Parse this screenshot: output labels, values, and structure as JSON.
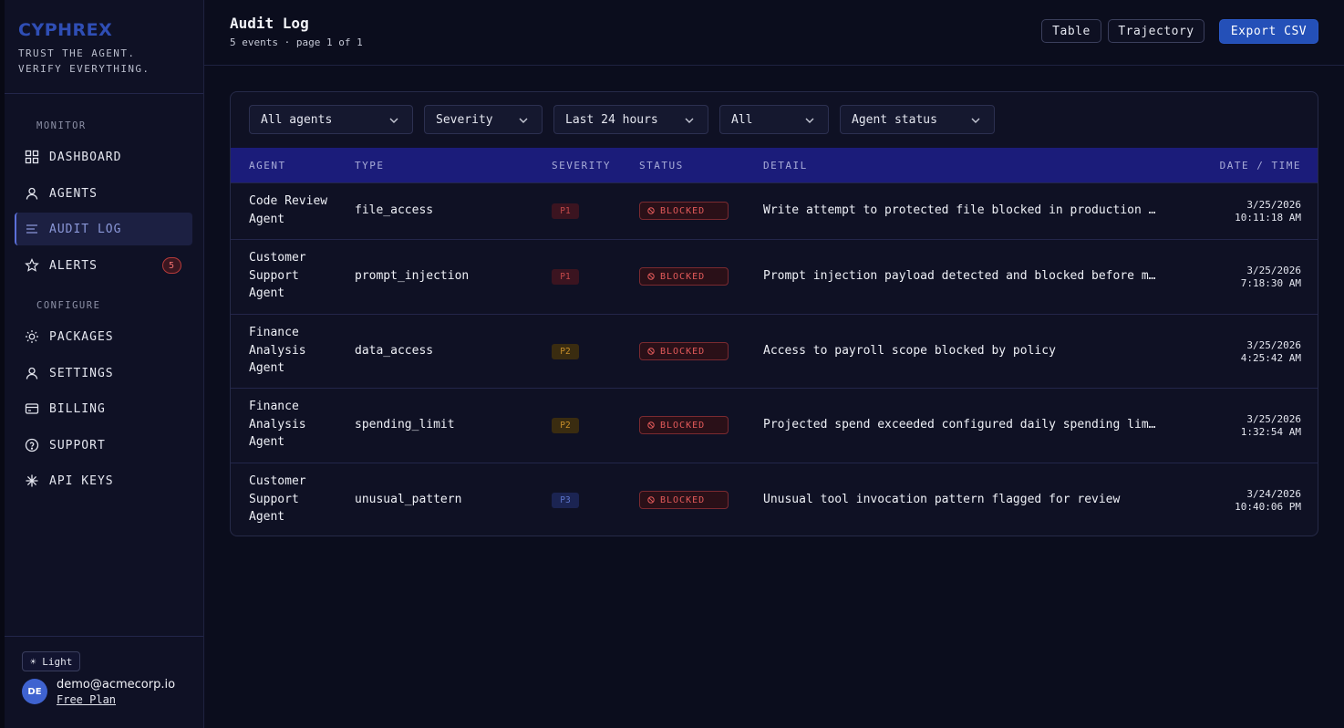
{
  "brand": {
    "logo": "CYPHREX",
    "tagline_1": "TRUST THE AGENT.",
    "tagline_2": "VERIFY EVERYTHING."
  },
  "sidebar": {
    "monitor_label": "MONITOR",
    "configure_label": "CONFIGURE",
    "items": [
      {
        "label": "DASHBOARD",
        "icon": "grid-icon"
      },
      {
        "label": "AGENTS",
        "icon": "user-icon"
      },
      {
        "label": "AUDIT LOG",
        "icon": "list-icon",
        "active": true
      },
      {
        "label": "ALERTS",
        "icon": "star-icon",
        "badge": "5"
      },
      {
        "label": "PACKAGES",
        "icon": "sun-icon"
      },
      {
        "label": "SETTINGS",
        "icon": "user-icon"
      },
      {
        "label": "BILLING",
        "icon": "card-icon"
      },
      {
        "label": "SUPPORT",
        "icon": "help-icon"
      },
      {
        "label": "API KEYS",
        "icon": "asterisk-icon"
      }
    ],
    "theme_toggle": "☀ Light",
    "user": {
      "initials": "DE",
      "email": "demo@acmecorp.io",
      "plan": "Free Plan"
    }
  },
  "header": {
    "title": "Audit Log",
    "subtitle": "5 events · page 1 of 1",
    "table_button": "Table",
    "trajectory_button": "Trajectory",
    "export_button": "Export CSV"
  },
  "filters": {
    "agents": "All agents",
    "severity": "Severity",
    "time_range": "Last 24 hours",
    "type": "All",
    "agent_status": "Agent status"
  },
  "table": {
    "columns": {
      "agent": "AGENT",
      "type": "TYPE",
      "severity": "SEVERITY",
      "status": "STATUS",
      "detail": "DETAIL",
      "datetime": "DATE / TIME"
    },
    "rows": [
      {
        "agent_1": "Code Review",
        "agent_2": "Agent",
        "agent_3": "",
        "type": "file_access",
        "severity": "P1",
        "status": "BLOCKED",
        "detail": "Write attempt to protected file blocked in production …",
        "date": "3/25/2026",
        "time": "10:11:18 AM"
      },
      {
        "agent_1": "Customer",
        "agent_2": "Support",
        "agent_3": "Agent",
        "type": "prompt_injection",
        "severity": "P1",
        "status": "BLOCKED",
        "detail": "Prompt injection payload detected and blocked before m…",
        "date": "3/25/2026",
        "time": "7:18:30 AM"
      },
      {
        "agent_1": "Finance",
        "agent_2": "Analysis",
        "agent_3": "Agent",
        "type": "data_access",
        "severity": "P2",
        "status": "BLOCKED",
        "detail": "Access to payroll scope blocked by policy",
        "date": "3/25/2026",
        "time": "4:25:42 AM"
      },
      {
        "agent_1": "Finance",
        "agent_2": "Analysis",
        "agent_3": "Agent",
        "type": "spending_limit",
        "severity": "P2",
        "status": "BLOCKED",
        "detail": "Projected spend exceeded configured daily spending lim…",
        "date": "3/25/2026",
        "time": "1:32:54 AM"
      },
      {
        "agent_1": "Customer",
        "agent_2": "Support",
        "agent_3": "Agent",
        "type": "unusual_pattern",
        "severity": "P3",
        "status": "BLOCKED",
        "detail": "Unusual tool invocation pattern flagged for review",
        "date": "3/24/2026",
        "time": "10:40:06 PM"
      }
    ]
  },
  "colors": {
    "accent": "#2450b8",
    "table_header": "#1b1c7a",
    "blocked": "#e35a5a",
    "p1": "#c54a4a",
    "p2": "#c98f2a",
    "p3": "#5e76cc"
  }
}
